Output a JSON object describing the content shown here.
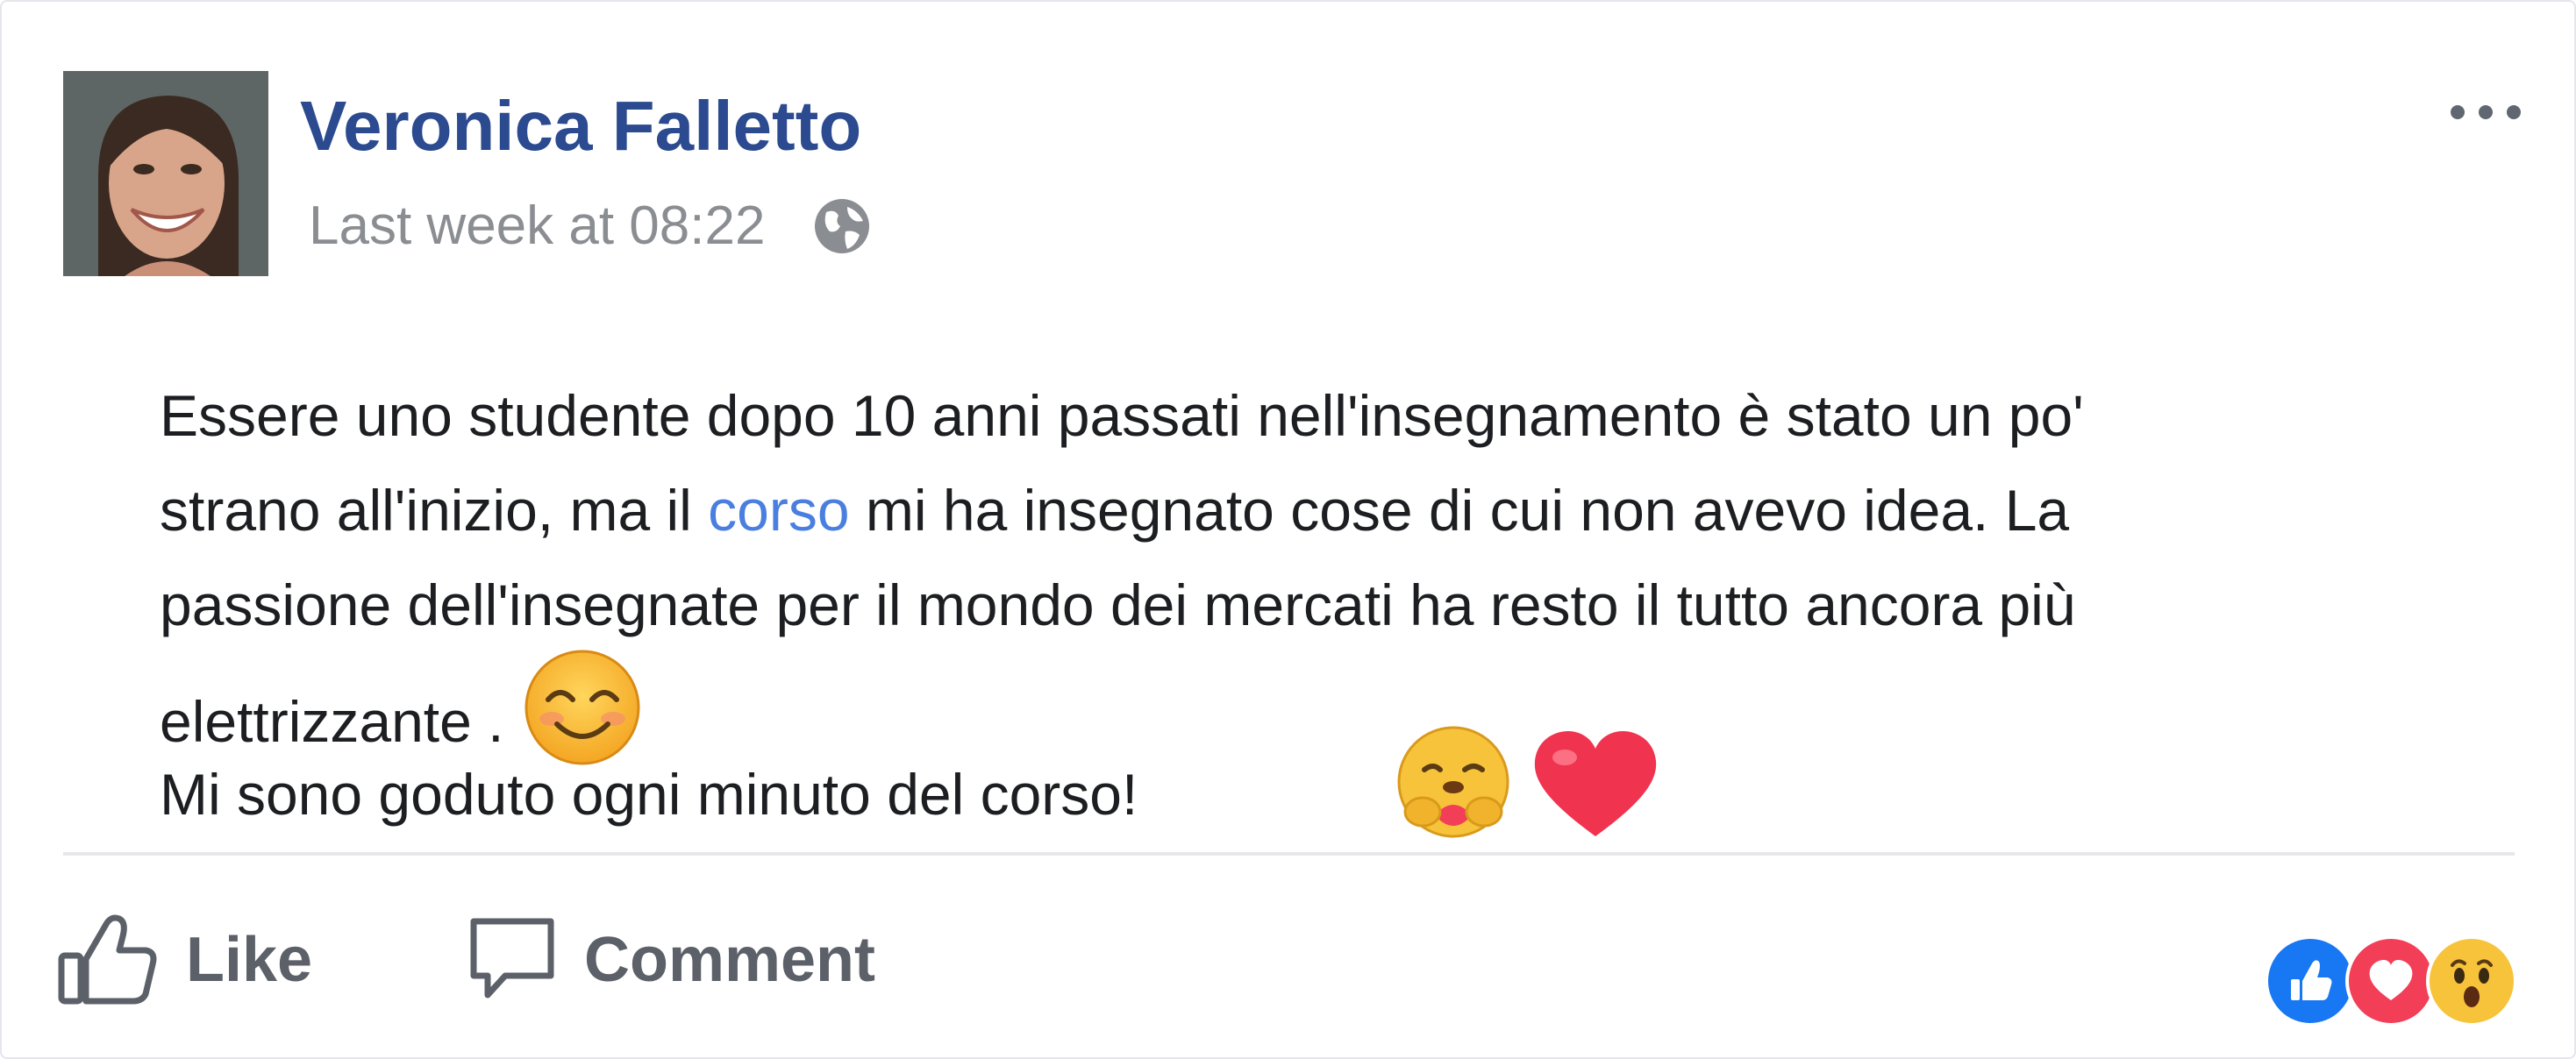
{
  "post": {
    "author": "Veronica Falletto",
    "timestamp": "Last week at 08:22",
    "privacy_icon": "globe-icon",
    "lines": {
      "l1": "Essere uno studente dopo 10 anni passati nell'insegnamento è stato un po'",
      "l2_before": "strano all'inizio, ma il ",
      "l2_link": "corso",
      "l2_after": " mi ha insegnato cose di cui non avevo idea. La",
      "l3": "passione dell'insegnate per il mondo dei mercati ha resto il tutto ancora più",
      "l4": "elettrizzante .",
      "l5": "Mi sono goduto ogni minuto del corso!"
    },
    "inline_emoji": "smiling-face-with-smiling-eyes",
    "stickers": [
      "care-hug-emoji",
      "red-heart-emoji"
    ]
  },
  "actions": {
    "like_label": "Like",
    "comment_label": "Comment"
  },
  "reactions": [
    "like",
    "love",
    "wow"
  ],
  "colors": {
    "name": "#2b4a8f",
    "link": "#4a7fe0",
    "like_blue": "#1877f2",
    "love_red": "#f33e58",
    "emoji_yellow": "#f7c33b"
  }
}
